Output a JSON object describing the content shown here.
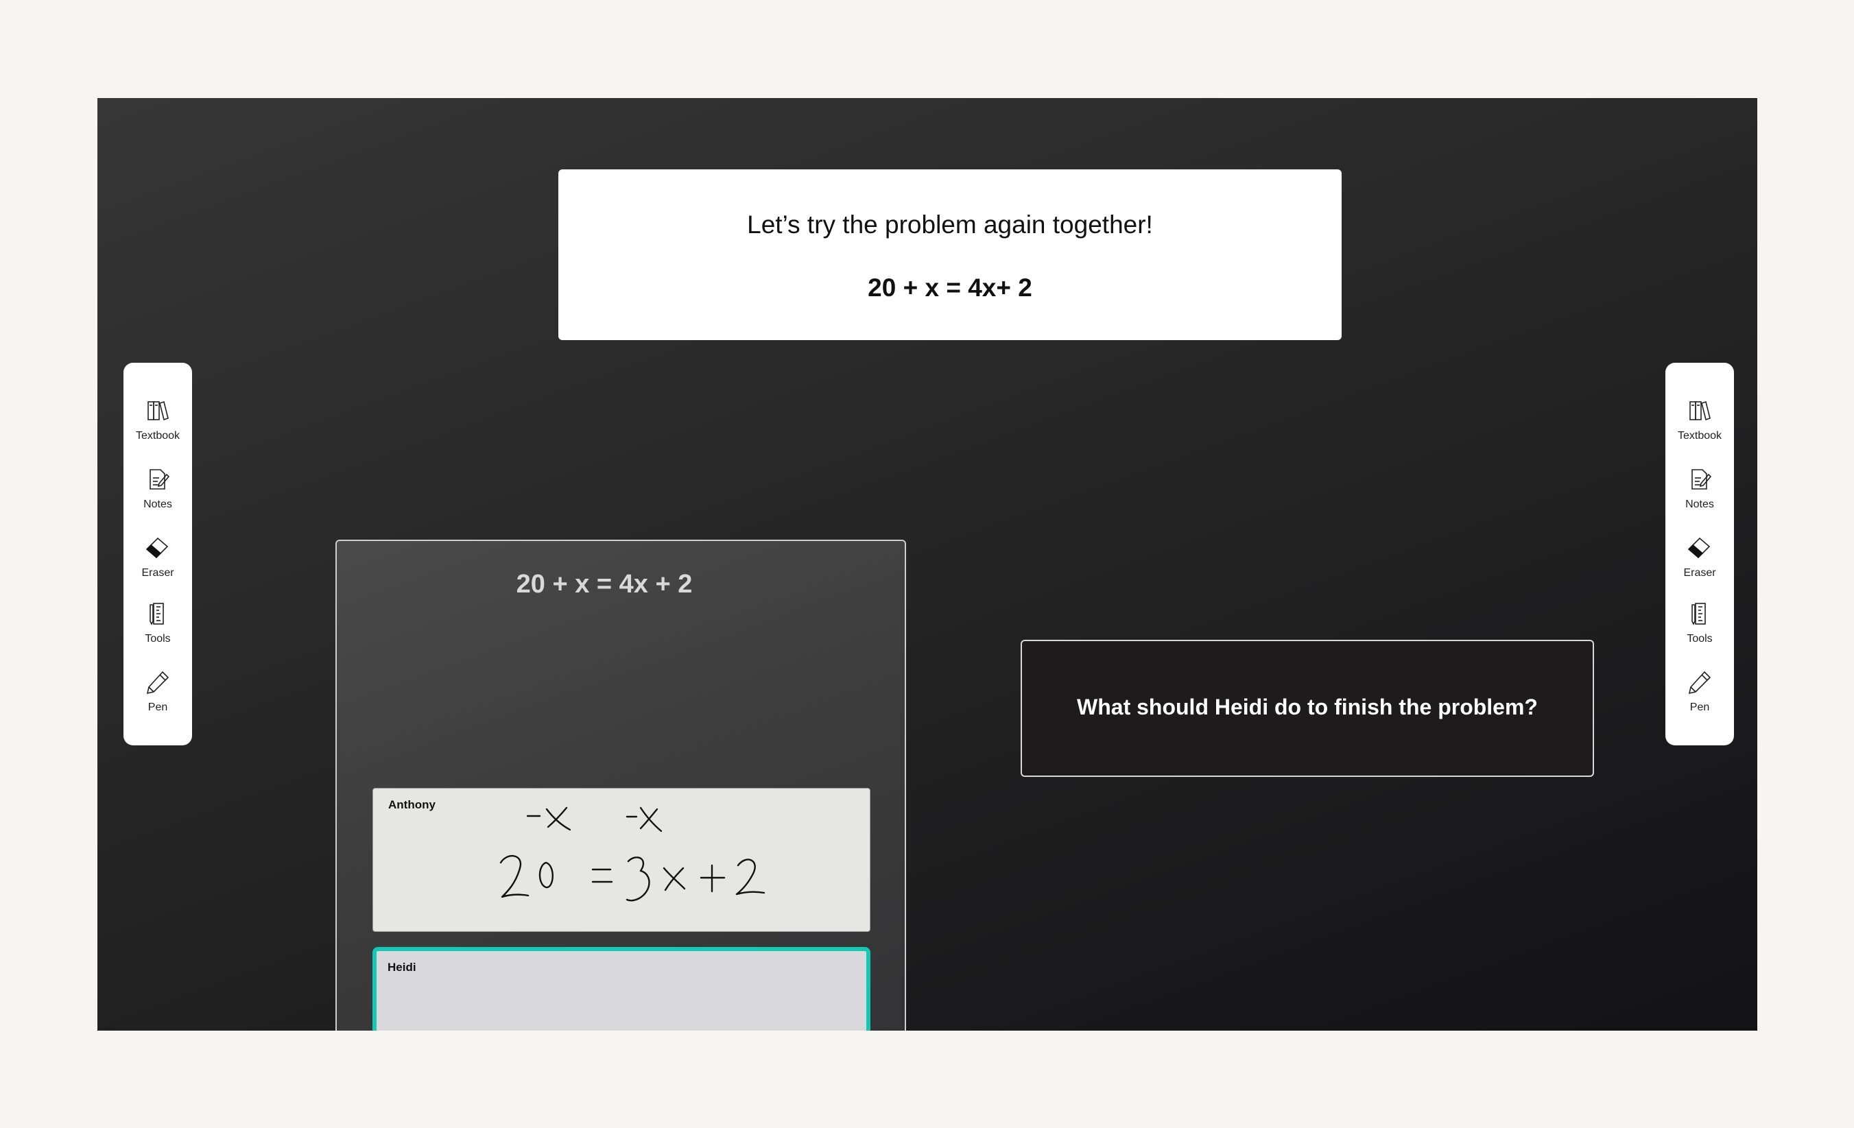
{
  "prompt": {
    "message": "Let’s try the problem again together!",
    "equation": "20 + x = 4x+ 2"
  },
  "toolbar": {
    "items": [
      {
        "label": "Textbook",
        "icon": "textbook-icon"
      },
      {
        "label": "Notes",
        "icon": "notes-icon"
      },
      {
        "label": "Eraser",
        "icon": "eraser-icon"
      },
      {
        "label": "Tools",
        "icon": "tools-icon"
      },
      {
        "label": "Pen",
        "icon": "pen-icon"
      }
    ]
  },
  "workspace": {
    "equation": "20 + x = 4x + 2",
    "students": [
      {
        "name": "Anthony",
        "work_lines": [
          "-x    -x",
          "20 = 3x+2"
        ]
      },
      {
        "name": "Heidi",
        "work_lines": []
      }
    ]
  },
  "question": {
    "text": "What should Heidi do to finish the problem?"
  },
  "colors": {
    "board_dark": "#262626",
    "active_outline": "#13c9b6",
    "card": "#ffffff"
  }
}
